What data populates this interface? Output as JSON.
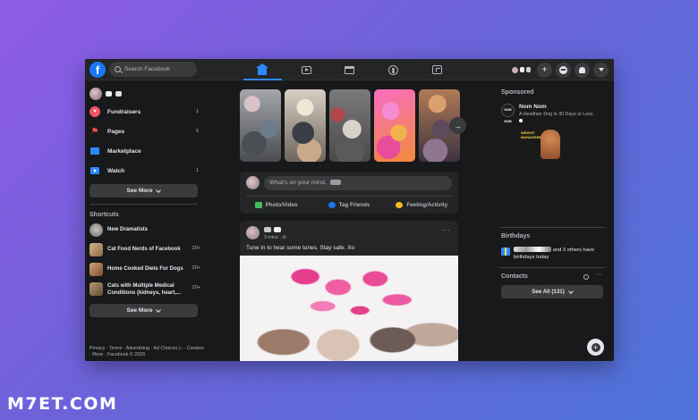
{
  "topbar": {
    "logo": "f",
    "search_placeholder": "Search Facebook",
    "nav_tabs": [
      {
        "name": "home",
        "icon": "home-icon",
        "active": true
      },
      {
        "name": "watch",
        "icon": "video-icon",
        "active": false
      },
      {
        "name": "marketplace",
        "icon": "marketplace-icon",
        "active": false
      },
      {
        "name": "groups",
        "icon": "groups-icon",
        "active": false
      },
      {
        "name": "gaming",
        "icon": "gaming-icon",
        "active": false
      }
    ],
    "create_label": "+",
    "accent_color": "#2d88ff"
  },
  "left": {
    "menu": [
      {
        "label": "Fundraisers",
        "count": "1",
        "color": "#f25268"
      },
      {
        "label": "Pages",
        "count": "9",
        "color": "#f5533d"
      },
      {
        "label": "Marketplace",
        "count": "",
        "color": "#2d88ff"
      },
      {
        "label": "Watch",
        "count": "1",
        "color": "#2d88ff"
      }
    ],
    "see_more_1": "See More",
    "shortcuts_title": "Shortcuts",
    "shortcuts": [
      {
        "label": "New Dramatists",
        "count": ""
      },
      {
        "label": "Cat Food Nerds of Facebook",
        "count": "20+"
      },
      {
        "label": "Home Cooked Diets For Dogs",
        "count": "20+"
      },
      {
        "label": "Cats with Multiple Medical Conditions (kidneys, heart,...",
        "count": "20+"
      }
    ],
    "see_more_2": "See More",
    "footer": "Privacy · Terms · Advertising · Ad Choices ▷ · Cookies · More · Facebook © 2020"
  },
  "center": {
    "composer_placeholder": "What's on your mind,",
    "actions": [
      {
        "label": "Photo/Video",
        "color": "#45bd62"
      },
      {
        "label": "Tag Friends",
        "color": "#1877f2"
      },
      {
        "label": "Feeling/Activity",
        "color": "#f7b928"
      }
    ],
    "post": {
      "time": "3 mins · ⊘",
      "more": "···",
      "text": "Tune in to hear some tunes. Stay safe. Xo"
    }
  },
  "right": {
    "sponsored_title": "Sponsored",
    "sponsor_logo": "NOM NOM",
    "sponsor_name": "Nom Nom",
    "sponsor_tagline": "A Healthier Dog in 30 Days or Less.",
    "sponsor_ad_text": "WEIGHT MANAGEMENT",
    "birthdays_title": "Birthdays",
    "birthday_text": "and 3 others have birthdays today",
    "contacts_title": "Contacts",
    "contacts_more": "···",
    "see_all": "See All (131)"
  },
  "watermark": "M7ET.COM"
}
